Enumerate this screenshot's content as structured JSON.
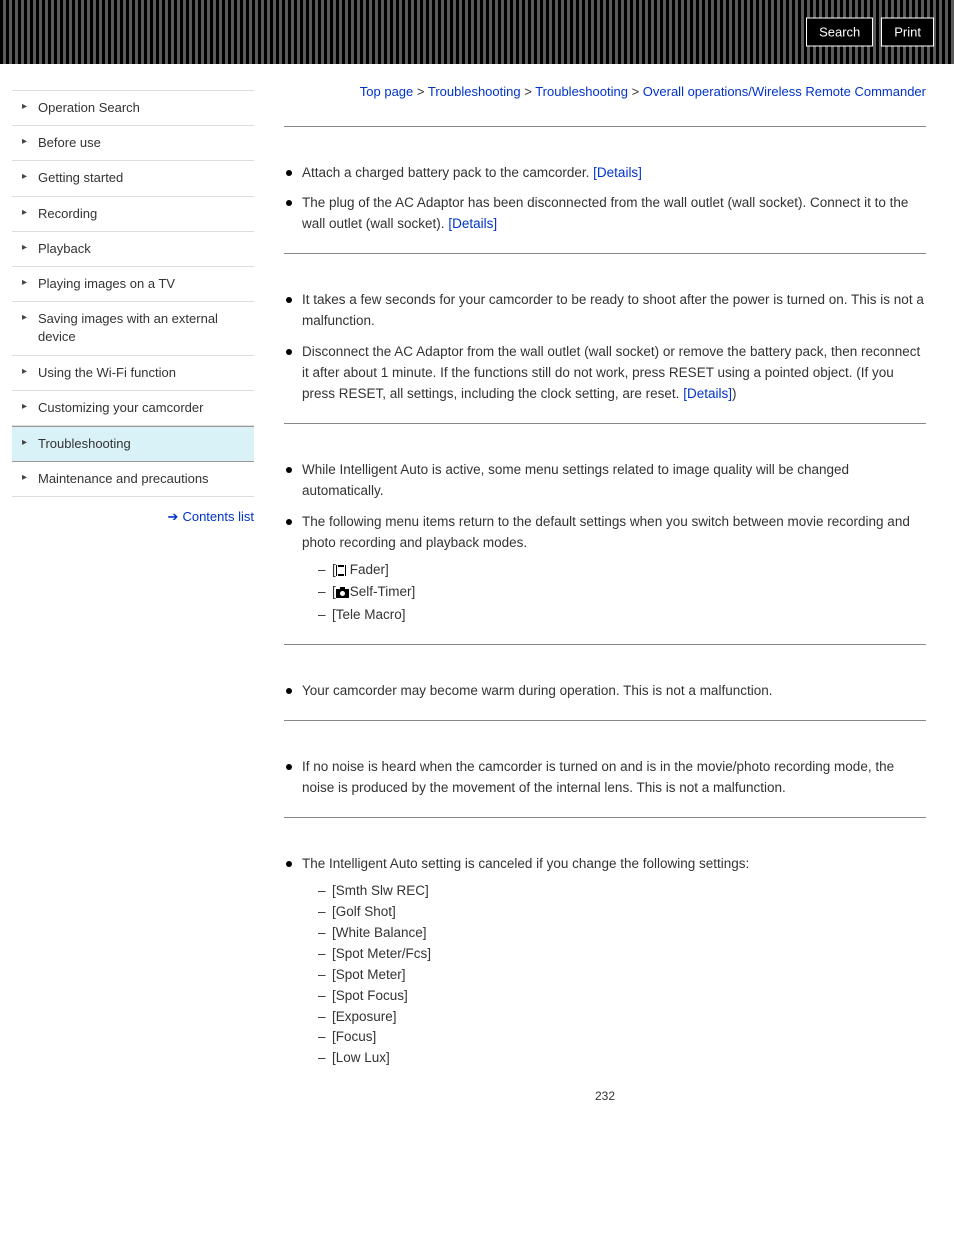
{
  "topbar": {
    "search_label": "Search",
    "print_label": "Print"
  },
  "sidebar": {
    "items": [
      {
        "label": "Operation Search"
      },
      {
        "label": "Before use"
      },
      {
        "label": "Getting started"
      },
      {
        "label": "Recording"
      },
      {
        "label": "Playback"
      },
      {
        "label": "Playing images on a TV"
      },
      {
        "label": "Saving images with an external device"
      },
      {
        "label": "Using the Wi-Fi function"
      },
      {
        "label": "Customizing your camcorder"
      },
      {
        "label": "Troubleshooting"
      },
      {
        "label": "Maintenance and precautions"
      }
    ],
    "contents_list_label": "Contents list"
  },
  "breadcrumb": {
    "top": "Top page",
    "ts1": "Troubleshooting",
    "ts2": "Troubleshooting",
    "current": "Overall operations/Wireless Remote Commander",
    "sep": " > "
  },
  "content": {
    "details_label": "[Details]",
    "s1": {
      "b1_pre": "Attach a charged battery pack to the camcorder. ",
      "b2_pre": "The plug of the AC Adaptor has been disconnected from the wall outlet (wall socket). Connect it to the wall outlet (wall socket). "
    },
    "s2": {
      "b1": "It takes a few seconds for your camcorder to be ready to shoot after the power is turned on. This is not a malfunction.",
      "b2_pre": "Disconnect the AC Adaptor from the wall outlet (wall socket) or remove the battery pack, then reconnect it after about 1 minute. If the functions still do not work, press RESET using a pointed object. (If you press RESET, all settings, including the clock setting, are reset. ",
      "b2_post": ")"
    },
    "s3": {
      "b1": "While Intelligent Auto is active, some menu settings related to image quality will be changed automatically.",
      "b2": "The following menu items return to the default settings when you switch between movie recording and photo recording and playback modes.",
      "sub": [
        "Fader]",
        "Self-Timer]",
        "[Tele Macro]"
      ],
      "sub_prefix_bracket": "["
    },
    "s4": {
      "b1": "Your camcorder may become warm during operation. This is not a malfunction."
    },
    "s5": {
      "b1": "If no noise is heard when the camcorder is turned on and is in the movie/photo recording mode, the noise is produced by the movement of the internal lens. This is not a malfunction."
    },
    "s6": {
      "b1": "The Intelligent Auto setting is canceled if you change the following settings:",
      "sub": [
        "[Smth Slw REC]",
        "[Golf Shot]",
        "[White Balance]",
        "[Spot Meter/Fcs]",
        "[Spot Meter]",
        "[Spot Focus]",
        "[Exposure]",
        "[Focus]",
        "[Low Lux]"
      ]
    }
  },
  "page_number": "232"
}
